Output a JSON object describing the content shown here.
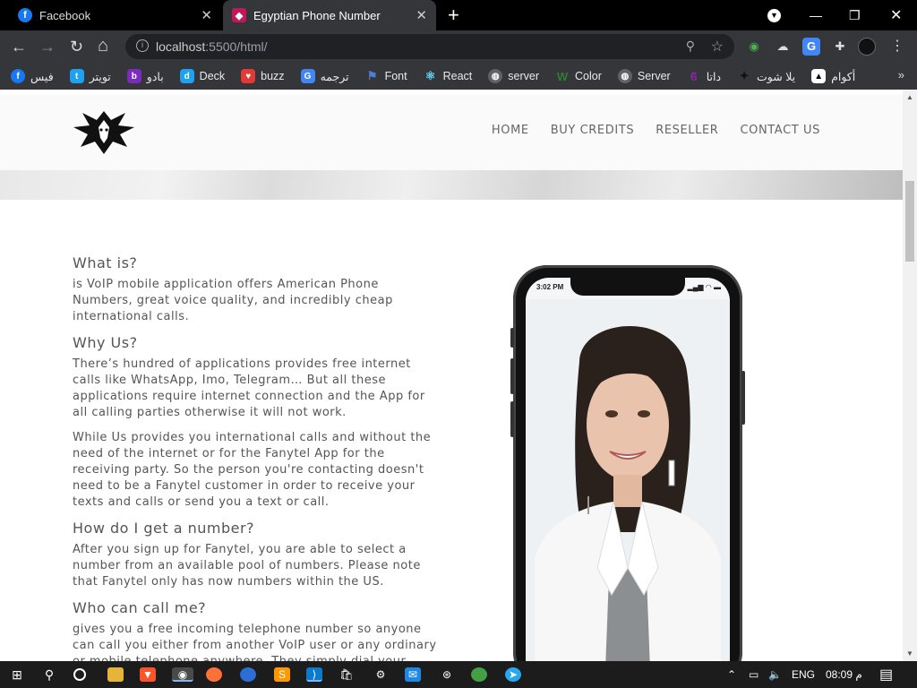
{
  "browser": {
    "tabs": [
      {
        "title": "Facebook",
        "icon": "facebook-icon",
        "active": false
      },
      {
        "title": "Egyptian Phone Number",
        "icon": "site-favicon",
        "active": true
      }
    ],
    "url_host": "localhost",
    "url_rest": ":5500/html/",
    "bookmarks": [
      {
        "label": "فيس",
        "icon": "facebook-icon",
        "color": "#1877f2"
      },
      {
        "label": "تويتر",
        "icon": "twitter-icon",
        "color": "#1da1f2"
      },
      {
        "label": "بادو",
        "icon": "badoo-icon",
        "color": "#7b2cbf"
      },
      {
        "label": "Deck",
        "icon": "tweetdeck-icon",
        "color": "#1da1f2"
      },
      {
        "label": "buzz",
        "icon": "buzz-icon",
        "color": "#e53935"
      },
      {
        "label": "ترجمه",
        "icon": "translate-icon",
        "color": "#4285f4"
      },
      {
        "label": "Font",
        "icon": "flag-icon",
        "color": "#4a7fd4"
      },
      {
        "label": "React",
        "icon": "react-icon",
        "color": "#61dafb"
      },
      {
        "label": "server",
        "icon": "globe-icon",
        "color": "#9aa0a6"
      },
      {
        "label": "Color",
        "icon": "wordpress-icon",
        "color": "#2e7d32"
      },
      {
        "label": "Server",
        "icon": "globe-icon",
        "color": "#9aa0a6"
      },
      {
        "label": "داتا",
        "icon": "data-icon",
        "color": "#8e24aa"
      },
      {
        "label": "يلا شوت",
        "icon": "yallashoot-icon",
        "color": "#333333"
      },
      {
        "label": "أكوام",
        "icon": "akwam-icon",
        "color": "#222222"
      }
    ]
  },
  "site": {
    "nav": [
      "HOME",
      "BUY CREDITS",
      "RESELLER",
      "CONTACT US"
    ],
    "sections": [
      {
        "heading": "What is?",
        "paragraphs": [
          "is VoIP mobile application offers American Phone Numbers, great voice quality, and incredibly cheap international calls."
        ]
      },
      {
        "heading": "Why Us?",
        "paragraphs": [
          "There’s hundred of applications provides free internet calls like WhatsApp, Imo, Telegram… But all these applications require internet connection and the App for all calling parties otherwise it will not work.",
          "While Us provides you international calls and without the need of the internet or for the Fanytel App for the receiving party. So the person you're contacting doesn't need to be a Fanytel customer in order to receive your texts and calls or send you a text or call."
        ]
      },
      {
        "heading": "How do I get a number?",
        "paragraphs": [
          "After you sign up for Fanytel, you are able to select a number from an available pool of numbers. Please note that Fanytel only has now numbers within the US."
        ]
      },
      {
        "heading": "Who can call me?",
        "paragraphs": [
          "gives you a free incoming telephone number so anyone can call you either from another VoIP user or any ordinary or mobile telephone anywhere. They simply dial your"
        ]
      }
    ],
    "phone": {
      "time": "3:02 PM"
    }
  },
  "taskbar": {
    "lang": "ENG",
    "clock": "08:09 م"
  }
}
